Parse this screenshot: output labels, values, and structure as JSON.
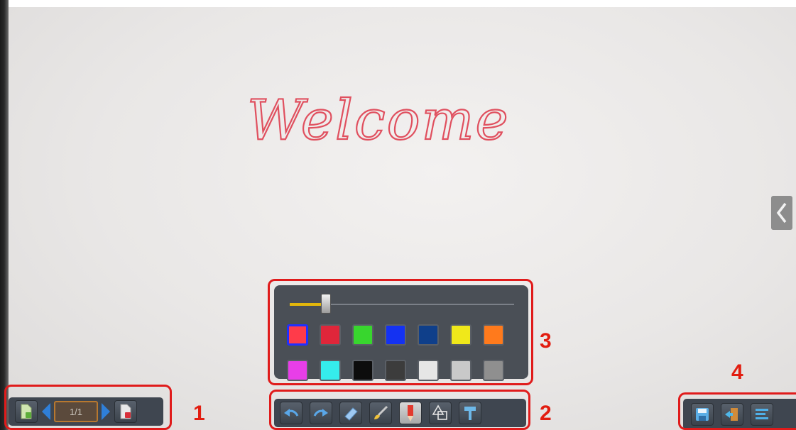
{
  "canvas": {
    "handwriting": "Welcome",
    "ink_color": "#e0505f"
  },
  "side_panel": {
    "toggle_icon": "chevron-left-icon"
  },
  "annotations": {
    "label_1": "1",
    "label_2": "2",
    "label_3": "3",
    "label_4": "4",
    "color": "#e01b1b"
  },
  "page_nav": {
    "add_page_icon": "new-page-icon",
    "prev_icon": "arrow-left-icon",
    "page_indicator": "1/1",
    "next_icon": "arrow-right-icon",
    "delete_page_icon": "delete-page-icon"
  },
  "toolbar": {
    "tools": [
      {
        "name": "undo",
        "icon": "undo-icon"
      },
      {
        "name": "redo",
        "icon": "redo-icon"
      },
      {
        "name": "eraser",
        "icon": "eraser-icon"
      },
      {
        "name": "brush",
        "icon": "brush-icon"
      },
      {
        "name": "pen",
        "icon": "pen-icon",
        "active": true
      },
      {
        "name": "shapes",
        "icon": "shapes-icon"
      },
      {
        "name": "clear",
        "icon": "clear-icon"
      }
    ]
  },
  "pen_settings": {
    "thickness_level": 0.16,
    "colors_row1": [
      "#ff3b4a",
      "#e0263a",
      "#38d62e",
      "#1432f2",
      "#0f3f8a",
      "#f0e81a",
      "#ff7a1c"
    ],
    "colors_row2": [
      "#e83ee8",
      "#35ecec",
      "#0d0d0d",
      "#3c3c3c",
      "#e6e6e6",
      "#c9c9c9",
      "#8f8f8f"
    ],
    "selected_color": "#ff3b4a"
  },
  "file_menu": {
    "save_icon": "save-icon",
    "exit_icon": "exit-icon",
    "menu_icon": "menu-icon"
  }
}
